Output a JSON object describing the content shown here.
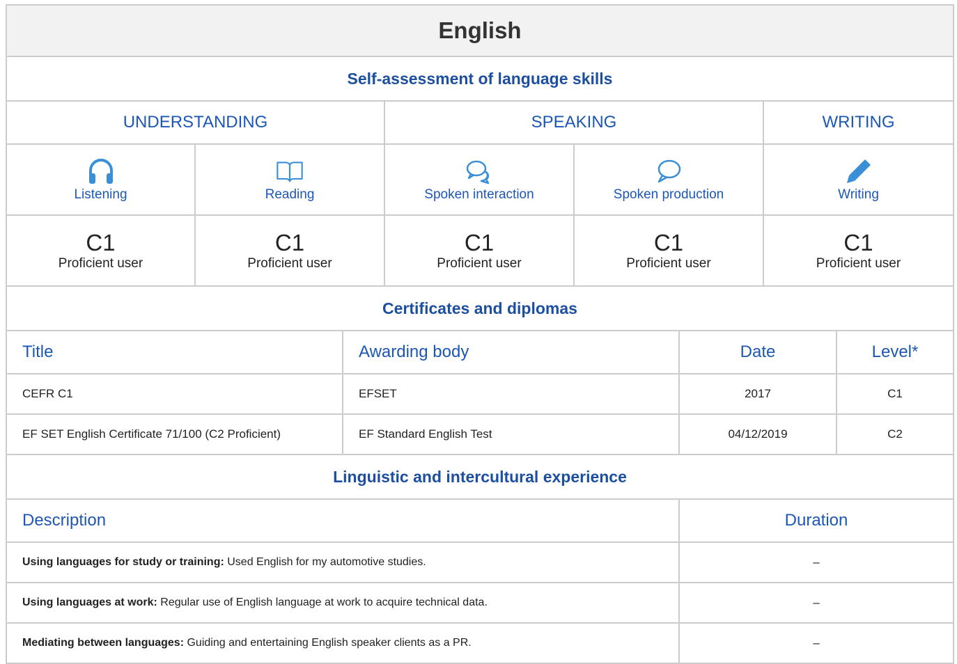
{
  "language": "English",
  "self_assessment": {
    "heading": "Self-assessment of language skills",
    "groups": [
      "UNDERSTANDING",
      "SPEAKING",
      "WRITING"
    ],
    "skills": [
      {
        "label": "Listening",
        "icon": "headphones-icon",
        "code": "C1",
        "level": "Proficient user"
      },
      {
        "label": "Reading",
        "icon": "book-icon",
        "code": "C1",
        "level": "Proficient user"
      },
      {
        "label": "Spoken interaction",
        "icon": "chat-bubbles-icon",
        "code": "C1",
        "level": "Proficient user"
      },
      {
        "label": "Spoken production",
        "icon": "speech-bubble-icon",
        "code": "C1",
        "level": "Proficient user"
      },
      {
        "label": "Writing",
        "icon": "pencil-icon",
        "code": "C1",
        "level": "Proficient user"
      }
    ]
  },
  "certificates": {
    "heading": "Certificates and diplomas",
    "columns": [
      "Title",
      "Awarding body",
      "Date",
      "Level*"
    ],
    "rows": [
      {
        "title": "CEFR C1",
        "body": "EFSET",
        "date": "2017",
        "level": "C1"
      },
      {
        "title": "EF SET English Certificate 71/100 (C2 Proficient)",
        "body": "EF Standard English Test",
        "date": "04/12/2019",
        "level": "C2"
      }
    ]
  },
  "experience": {
    "heading": "Linguistic and intercultural experience",
    "columns": [
      "Description",
      "Duration"
    ],
    "rows": [
      {
        "label": "Using languages for study or training:",
        "text": " Used English for my automotive studies.",
        "duration": "–"
      },
      {
        "label": "Using languages at work:",
        "text": " Regular use of English language at work to acquire technical data.",
        "duration": "–"
      },
      {
        "label": "Mediating between languages:",
        "text": " Guiding and entertaining English speaker clients as a PR.",
        "duration": "–"
      }
    ]
  },
  "colors": {
    "accent": "#1d57b5",
    "heading": "#1d4fa0",
    "border": "#cccccc",
    "title_bg": "#f2f2f2",
    "icon": "#3a8fd6"
  }
}
